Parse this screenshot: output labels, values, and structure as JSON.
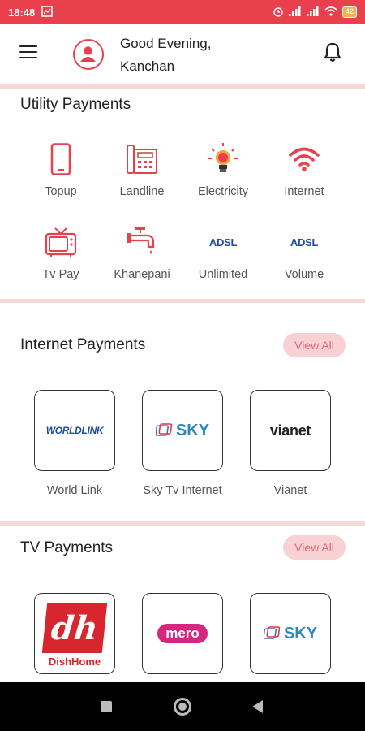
{
  "status": {
    "time": "18:48",
    "battery": "42"
  },
  "header": {
    "greeting_line1": "Good Evening,",
    "greeting_line2": "Kanchan"
  },
  "utility": {
    "title": "Utility Payments",
    "items": [
      {
        "label": "Topup",
        "icon": "mobile-phone-icon"
      },
      {
        "label": "Landline",
        "icon": "landline-phone-icon"
      },
      {
        "label": "Electricity",
        "icon": "lightbulb-icon"
      },
      {
        "label": "Internet",
        "icon": "wifi-icon"
      },
      {
        "label": "Tv Pay",
        "icon": "tv-icon"
      },
      {
        "label": "Khanepani",
        "icon": "water-tap-icon"
      },
      {
        "label": "Unlimited",
        "icon": "adsl-icon",
        "icon_text": "ADSL"
      },
      {
        "label": "Volume",
        "icon": "adsl-icon",
        "icon_text": "ADSL"
      }
    ]
  },
  "internet": {
    "title": "Internet Payments",
    "view_all": "View All",
    "items": [
      {
        "label": "World Link",
        "logo_text": "WORLDLINK"
      },
      {
        "label": "Sky Tv Internet",
        "logo_text": "SKY"
      },
      {
        "label": "Vianet",
        "logo_text": "vianet"
      }
    ]
  },
  "tv": {
    "title": "TV Payments",
    "view_all": "View All",
    "items": [
      {
        "logo_text": "DishHome",
        "logo_mark": "dh"
      },
      {
        "logo_text": "mero"
      },
      {
        "logo_text": "SKY"
      }
    ]
  },
  "colors": {
    "accent": "#e8404c",
    "accent_light": "#f7d1d4",
    "adsl_blue": "#1f4b9c"
  }
}
